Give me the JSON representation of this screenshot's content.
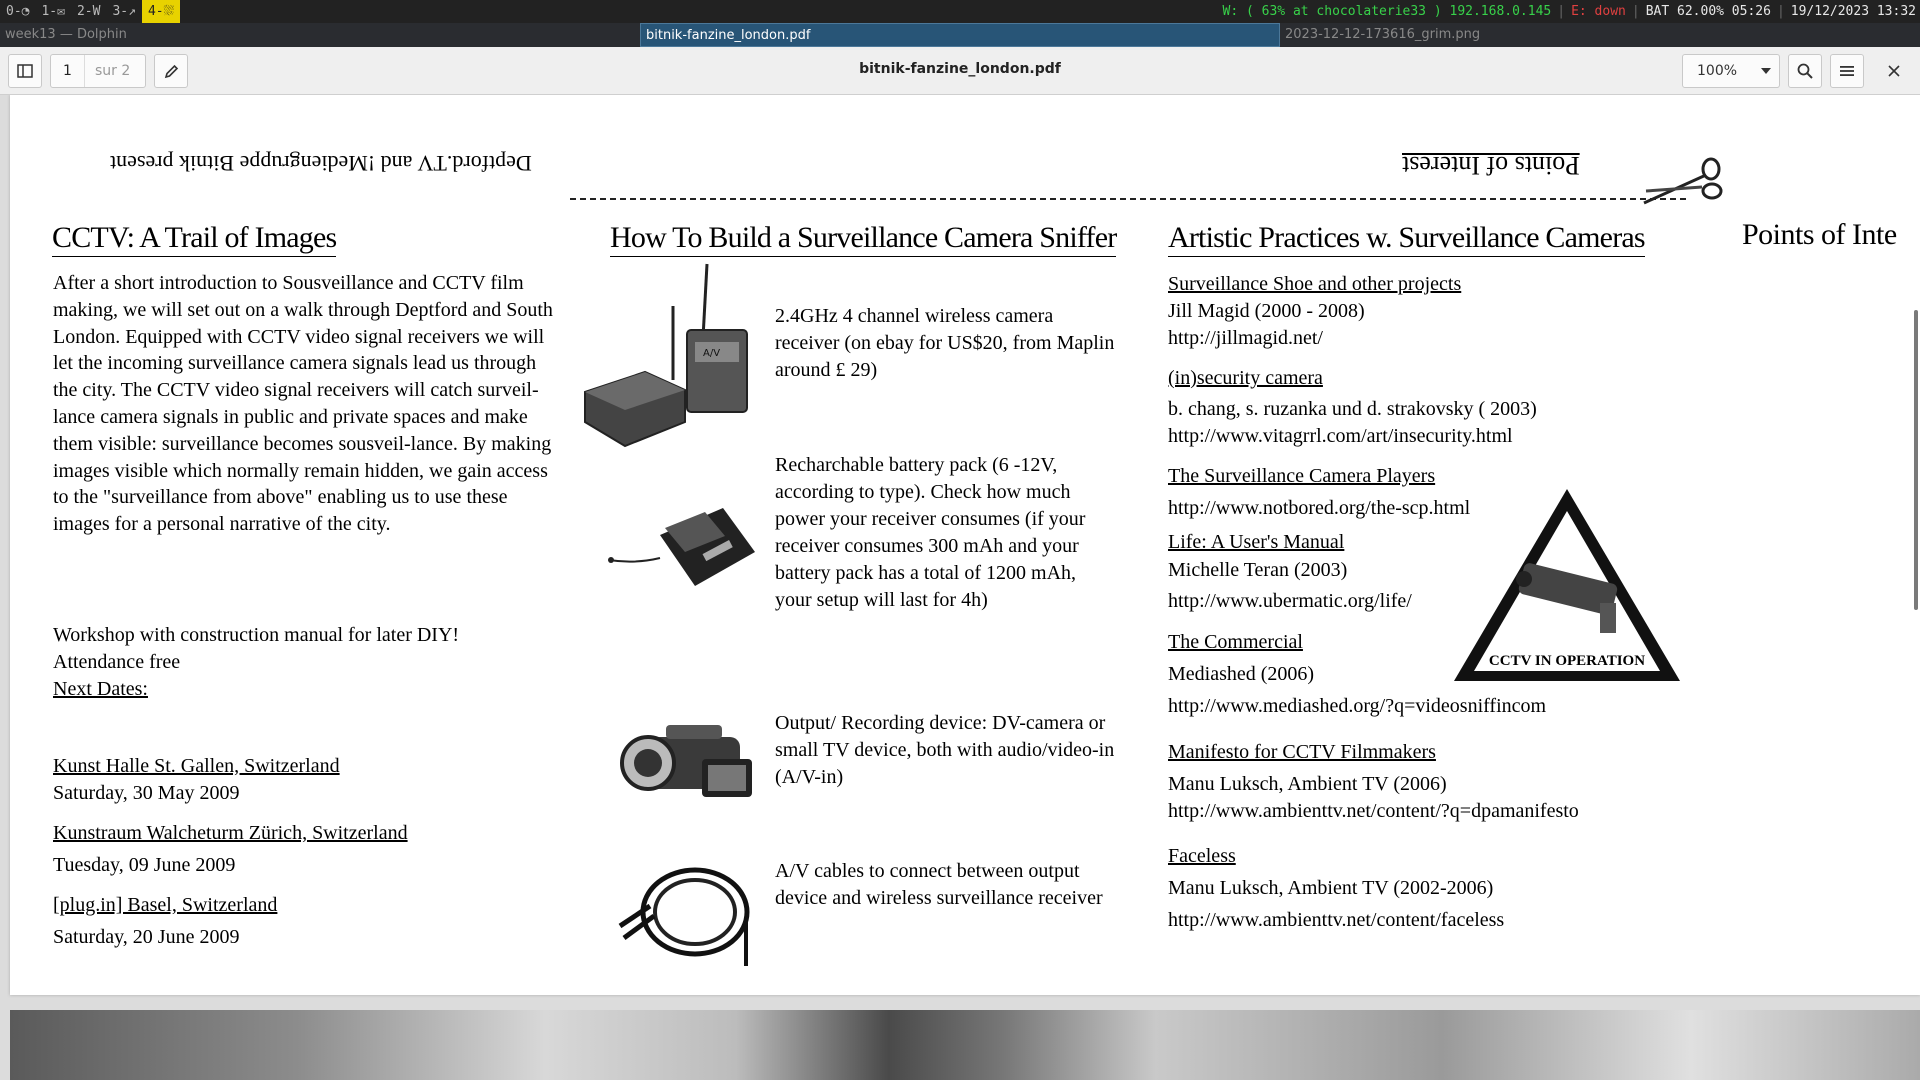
{
  "statusbar": {
    "workspaces": [
      "0-◔",
      "1-✉",
      "2-W",
      "3-↗",
      "4-⛆"
    ],
    "active_workspace": 4,
    "wifi": "W: ( 63% at chocolaterie33 ) 192.168.0.145",
    "ethernet": "E: down",
    "battery": "BAT 62.00% 05:26",
    "datetime": "19/12/2023 13:32"
  },
  "titlebar": {
    "tabs": [
      "week13 — Dolphin",
      "bitnik-fanzine_london.pdf",
      "2023-12-12-173616_grim.png"
    ],
    "active_tab": 1
  },
  "toolbar": {
    "page_number": "1",
    "page_total": "sur 2",
    "doc_title": "bitnik-fanzine_london.pdf",
    "zoom": "100%"
  },
  "page": {
    "flipped_left": "Deptford.TV and !Mediengruppe Bitnik present",
    "flipped_right": "Points of Interest",
    "left": {
      "heading": "CCTV: A Trail of Images",
      "intro": "After a short introduction to Sousveillance and CCTV film making, we will set out on a walk through Deptford and South London. Equipped with CCTV video signal receivers we will let the incoming surveillance camera signals lead us through the city. The CCTV video signal receivers will catch surveil-lance camera signals in public and private spaces and make them visible: surveillance becomes sousveil-lance. By making images visible which normally remain hidden, we gain access to the \"surveillance from above\" enabling us to use these images for a personal narrative of the city.",
      "workshop_1": "Workshop with construction manual for later DIY!",
      "workshop_2": "Attendance free",
      "next_dates_label": "Next Dates:",
      "dates": [
        {
          "venue": "Kunst Halle St. Gallen, Switzerland",
          "day": "Saturday, 30 May 2009"
        },
        {
          "venue": "Kunstraum Walcheturm Zürich, Switzerland",
          "day": "Tuesday, 09 June 2009"
        },
        {
          "venue": "[plug.in] Basel, Switzerland",
          "day": "Saturday, 20 June 2009"
        }
      ]
    },
    "middle": {
      "heading": "How To Build a Surveillance Camera Sniffer",
      "items": [
        "2.4GHz 4 channel wireless camera receiver (on ebay for US$20, from Maplin around £ 29)",
        "Recharchable battery pack (6 -12V, according to type). Check how much power your receiver consumes (if your receiver consumes 300 mAh and your battery pack has a total of 1200 mAh, your setup will last for 4h)",
        "Output/ Recording device: DV-camera or small TV device, both with audio/video-in (A/V-in)",
        "A/V cables to connect between output device and wireless surveillance receiver"
      ],
      "receiver_label": "A/V"
    },
    "right": {
      "heading": "Artistic Practices w. Surveillance Cameras",
      "edge_heading": "Points of Inte",
      "projects": [
        {
          "title": "Surveillance Shoe and other projects",
          "lines": [
            "Jill Magid (2000 - 2008)",
            "http://jillmagid.net/"
          ]
        },
        {
          "title": "(in)security camera",
          "lines": [
            "b. chang, s. ruzanka und d. strakovsky ( 2003)",
            "http://www.vitagrrl.com/art/insecurity.html"
          ]
        },
        {
          "title": "The Surveillance Camera Players",
          "lines": [
            "http://www.notbored.org/the-scp.html"
          ]
        },
        {
          "title": "Life: A User's Manual",
          "lines": [
            "Michelle Teran (2003)",
            "http://www.ubermatic.org/life/"
          ]
        },
        {
          "title": "The Commercial",
          "lines": [
            "Mediashed (2006)",
            "http://www.mediashed.org/?q=videosniffincom"
          ]
        },
        {
          "title": "Manifesto for CCTV Filmmakers",
          "lines": [
            "Manu Luksch, Ambient TV (2006)",
            "http://www.ambienttv.net/content/?q=dpamanifesto"
          ]
        },
        {
          "title": "Faceless",
          "lines": [
            "Manu Luksch, Ambient TV (2002-2006)",
            "http://www.ambienttv.net/content/faceless"
          ]
        }
      ],
      "sign_text": "CCTV IN OPERATION"
    }
  }
}
